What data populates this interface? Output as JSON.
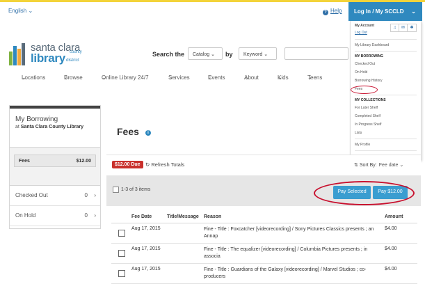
{
  "header": {
    "language": "English",
    "help": "Help",
    "login": "Log In / My SCCLD"
  },
  "account_menu": {
    "title": "My Account",
    "logout": "Log Out",
    "dashboard": "My Library Dashboard",
    "borrowing_heading": "MY BORROWING",
    "borrowing_items": [
      "Checked Out",
      "On Hold",
      "Borrowing History",
      "Fees"
    ],
    "collections_heading": "MY COLLECTIONS",
    "collection_items": [
      "For Later Shelf",
      "Completed Shelf",
      "In Progress Shelf",
      "Lists"
    ],
    "profile": "My Profile",
    "settings": "My Settings"
  },
  "logo": {
    "line1": "santa clara",
    "line2": "county",
    "line3": "library",
    "line4": "district"
  },
  "search": {
    "label": "Search the",
    "catalog": "Catalog",
    "by": "by",
    "keyword": "Keyword"
  },
  "nav": [
    "Locations",
    "Browse",
    "Online Library 24/7",
    "Services",
    "Events",
    "About",
    "Kids",
    "Teens"
  ],
  "sidebar": {
    "title": "My Borrowing",
    "at": "at",
    "library": "Santa Clara County Library",
    "fees_label": "Fees",
    "fees_amount": "$12.00",
    "checked_out_label": "Checked Out",
    "checked_out_count": "0",
    "on_hold_label": "On Hold",
    "on_hold_count": "0"
  },
  "main": {
    "title": "Fees",
    "due_badge": "$12.00 Due",
    "refresh": "Refresh Totals",
    "sort_label": "Sort By:",
    "sort_value": "Fee date",
    "item_count": "1-3 of 3 items",
    "pay_selected": "Pay Selected",
    "pay_total": "Pay $12.00"
  },
  "table": {
    "headers": [
      "Fee Date",
      "Title/Message",
      "Reason",
      "Amount"
    ],
    "rows": [
      {
        "date": "Aug 17, 2015",
        "reason": "Fine - Title : Foxcatcher [videorecording] / Sony Pictures Classics presents ; an Annap",
        "amount": "$4.00"
      },
      {
        "date": "Aug 17, 2015",
        "reason": "Fine - Title : The equalizer [videorecording] / Columbia Pictures presents ; in associa",
        "amount": "$4.00"
      },
      {
        "date": "Aug 17, 2015",
        "reason": "Fine - Title : Guardians of the Galaxy [videorecording] / Marvel Studios ; co-producers",
        "amount": "$4.00"
      }
    ]
  },
  "colors": {
    "accent": "#2f89bf",
    "due": "#c9302c",
    "highlight": "#c8102e",
    "topstrip": "#f3d33a"
  }
}
